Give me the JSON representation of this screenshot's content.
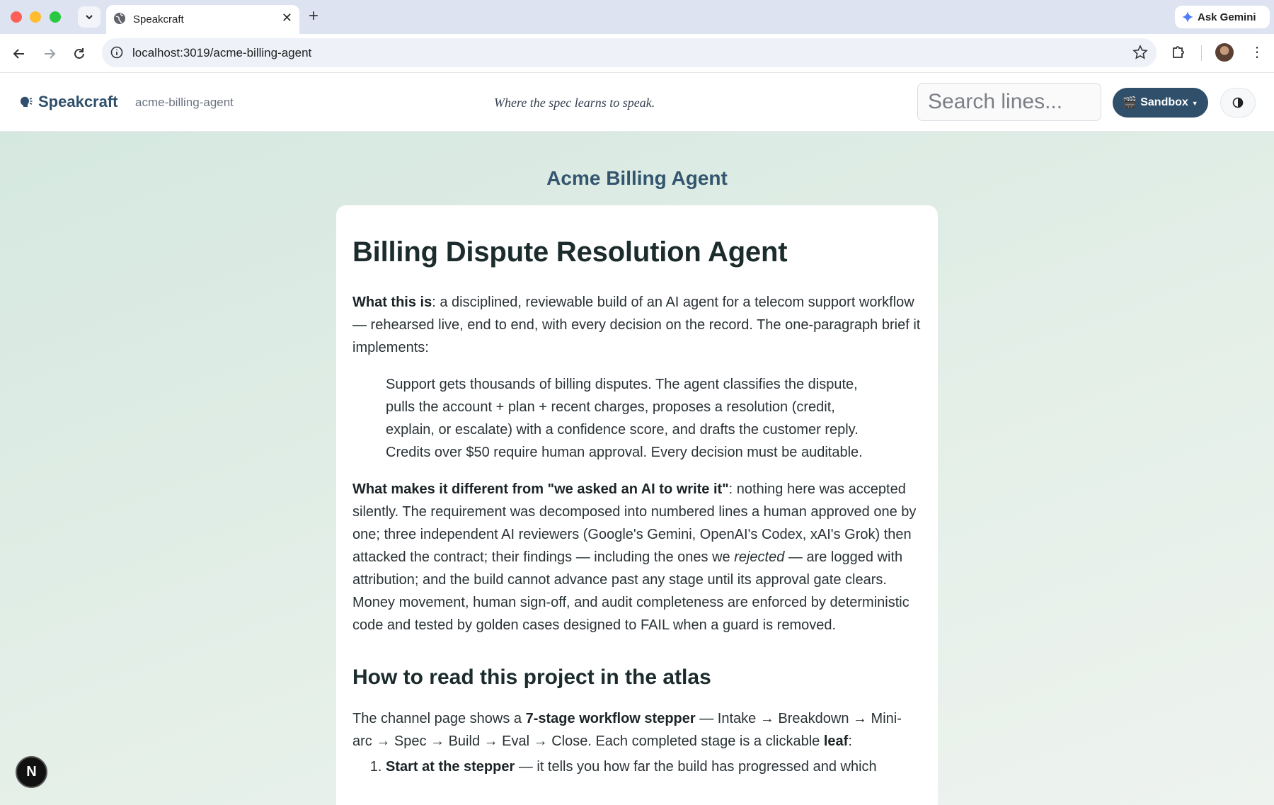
{
  "browser": {
    "tab_title": "Speakcraft",
    "url": "localhost:3019/acme-billing-agent",
    "gemini_label": "Ask Gemini"
  },
  "header": {
    "brand": "Speakcraft",
    "project_slug": "acme-billing-agent",
    "tagline": "Where the spec learns to speak.",
    "search_placeholder": "Search lines...",
    "sandbox_label": "Sandbox",
    "sandbox_icon": "🎬",
    "brand_icon": "speech-head-icon"
  },
  "main": {
    "channel_title": "Acme Billing Agent",
    "doc": {
      "title": "Billing Dispute Resolution Agent",
      "p1_bold": "What this is",
      "p1_text": ": a disciplined, reviewable build of an AI agent for a telecom support workflow — rehearsed live, end to end, with every decision on the record. The one-paragraph brief it implements:",
      "quote": "Support gets thousands of billing disputes. The agent classifies the dispute, pulls the account + plan + recent charges, proposes a resolution (credit, explain, or escalate) with a confidence score, and drafts the customer reply. Credits over $50 require human approval. Every decision must be auditable.",
      "p2_bold": "What makes it different from \"we asked an AI to write it\"",
      "p2_text_a": ": nothing here was accepted silently. The requirement was decomposed into numbered lines a human approved one by one; three independent AI reviewers (Google's Gemini, OpenAI's Codex, xAI's Grok) then attacked the contract; their findings — including the ones we ",
      "p2_em": "rejected",
      "p2_text_b": " — are logged with attribution; and the build cannot advance past any stage until its approval gate clears. Money movement, human sign-off, and audit completeness are enforced by deterministic code and tested by golden cases designed to FAIL when a guard is removed.",
      "h2": "How to read this project in the atlas",
      "p3_a": "The channel page shows a ",
      "p3_bold1": "7-stage workflow stepper",
      "p3_b": " — Intake → Breakdown → Mini-arc → Spec → Build → Eval → Close. Each completed stage is a clickable ",
      "p3_bold2": "leaf",
      "p3_c": ":",
      "li1_bold": "Start at the stepper",
      "li1_text": " — it tells you how far the build has progressed and which"
    }
  },
  "badge": {
    "letter": "N"
  },
  "colors": {
    "accent": "#2f4f6b",
    "tab_strip": "#dde3f1",
    "background_gradient_start": "#d5e8e0"
  }
}
